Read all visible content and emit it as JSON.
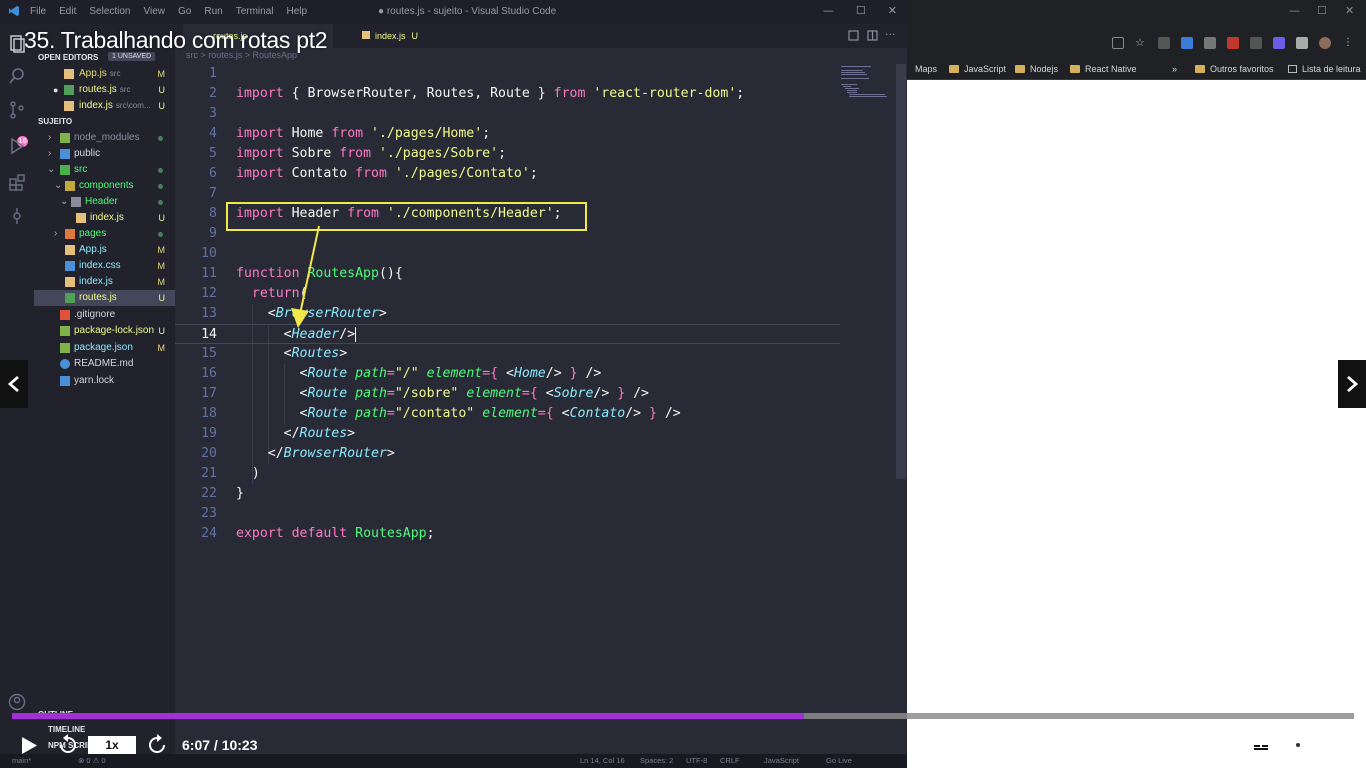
{
  "video": {
    "title": "35. Trabalhando com rotas pt2",
    "speed": "1x",
    "time": "6:07 / 10:23",
    "progress": 0.59
  },
  "vscode": {
    "menu": [
      "File",
      "Edit",
      "Selection",
      "View",
      "Go",
      "Run",
      "Terminal",
      "Help"
    ],
    "window_title": "● routes.js - sujeito - Visual Studio Code",
    "tabs": [
      {
        "label": "routes.js",
        "status": "U"
      },
      {
        "label": "index.js",
        "status": "U"
      }
    ],
    "breadcrumb": "src  >  routes.js  >  RoutesApp",
    "sidebar": {
      "open_editors_header": "OPEN EDITORS",
      "unsaved_badge": "1 UNSAVED",
      "open_editors": [
        {
          "name": "App.js",
          "path": "src",
          "status": "M"
        },
        {
          "name": "routes.js",
          "path": "src",
          "status": "U"
        },
        {
          "name": "index.js",
          "path": "src\\com...",
          "status": "U"
        }
      ],
      "project_header": "SUJEITO",
      "tree": [
        {
          "name": "node_modules",
          "status": "dot"
        },
        {
          "name": "public",
          "status": ""
        },
        {
          "name": "src",
          "status": "dot"
        },
        {
          "name": "components",
          "status": "dot"
        },
        {
          "name": "Header",
          "status": "dot"
        },
        {
          "name": "index.js",
          "status": "U"
        },
        {
          "name": "pages",
          "status": "dot"
        },
        {
          "name": "App.js",
          "status": "M"
        },
        {
          "name": "index.css",
          "status": "M"
        },
        {
          "name": "index.js",
          "status": "M"
        },
        {
          "name": "routes.js",
          "status": "U"
        },
        {
          "name": ".gitignore",
          "status": ""
        },
        {
          "name": "package-lock.json",
          "status": "U"
        },
        {
          "name": "package.json",
          "status": "M"
        },
        {
          "name": "README.md",
          "status": ""
        },
        {
          "name": "yarn.lock",
          "status": ""
        }
      ],
      "outline_header": "OUTLINE",
      "timeline_header": "TIMELINE",
      "npm_header": "NPM SCRIPTS"
    },
    "status_bar": {
      "branch": "main*",
      "problems": "⊗ 0  ⚠ 0",
      "position": "Ln 14, Col 16",
      "spaces": "Spaces: 2",
      "encoding": "UTF-8",
      "eol": "CRLF",
      "language": "JavaScript",
      "golive": "Go Live"
    },
    "code": {
      "line_numbers": [
        "1",
        "2",
        "3",
        "4",
        "5",
        "6",
        "7",
        "8",
        "9",
        "10",
        "11",
        "12",
        "13",
        "14",
        "15",
        "16",
        "17",
        "18",
        "19",
        "20",
        "21",
        "22",
        "23",
        "24"
      ],
      "import_kw": "import",
      "from_kw": "from",
      "function_kw": "function",
      "return_kw": "return",
      "export_kw": "export",
      "default_kw": "default",
      "l2_names": "{ BrowserRouter, Routes, Route }",
      "l2_src": "'react-router-dom'",
      "l4_name": "Home",
      "l4_src": "'./pages/Home'",
      "l5_name": "Sobre",
      "l5_src": "'./pages/Sobre'",
      "l6_name": "Contato",
      "l6_src": "'./pages/Contato'",
      "l8_name": "Header",
      "l8_src": "'./components/Header'",
      "fn_name": "RoutesApp",
      "tag_browser_router": "BrowserRouter",
      "tag_header": "Header",
      "tag_routes": "Routes",
      "tag_route": "Route",
      "attr_path": "path",
      "attr_element": "element",
      "path_home": "\"/\"",
      "path_sobre": "\"/sobre\"",
      "path_contato": "\"/contato\"",
      "comp_home": "Home",
      "comp_sobre": "Sobre",
      "comp_contato": "Contato"
    }
  },
  "browser": {
    "bookmarks": [
      "Maps",
      "JavaScript",
      "Nodejs",
      "React Native",
      "»",
      "Outros favoritos",
      "Lista de leitura"
    ]
  },
  "colors": {
    "progress_fill": "#a22fd8",
    "highlight_box": "#f1e94a",
    "editor_bg": "#282a36"
  }
}
